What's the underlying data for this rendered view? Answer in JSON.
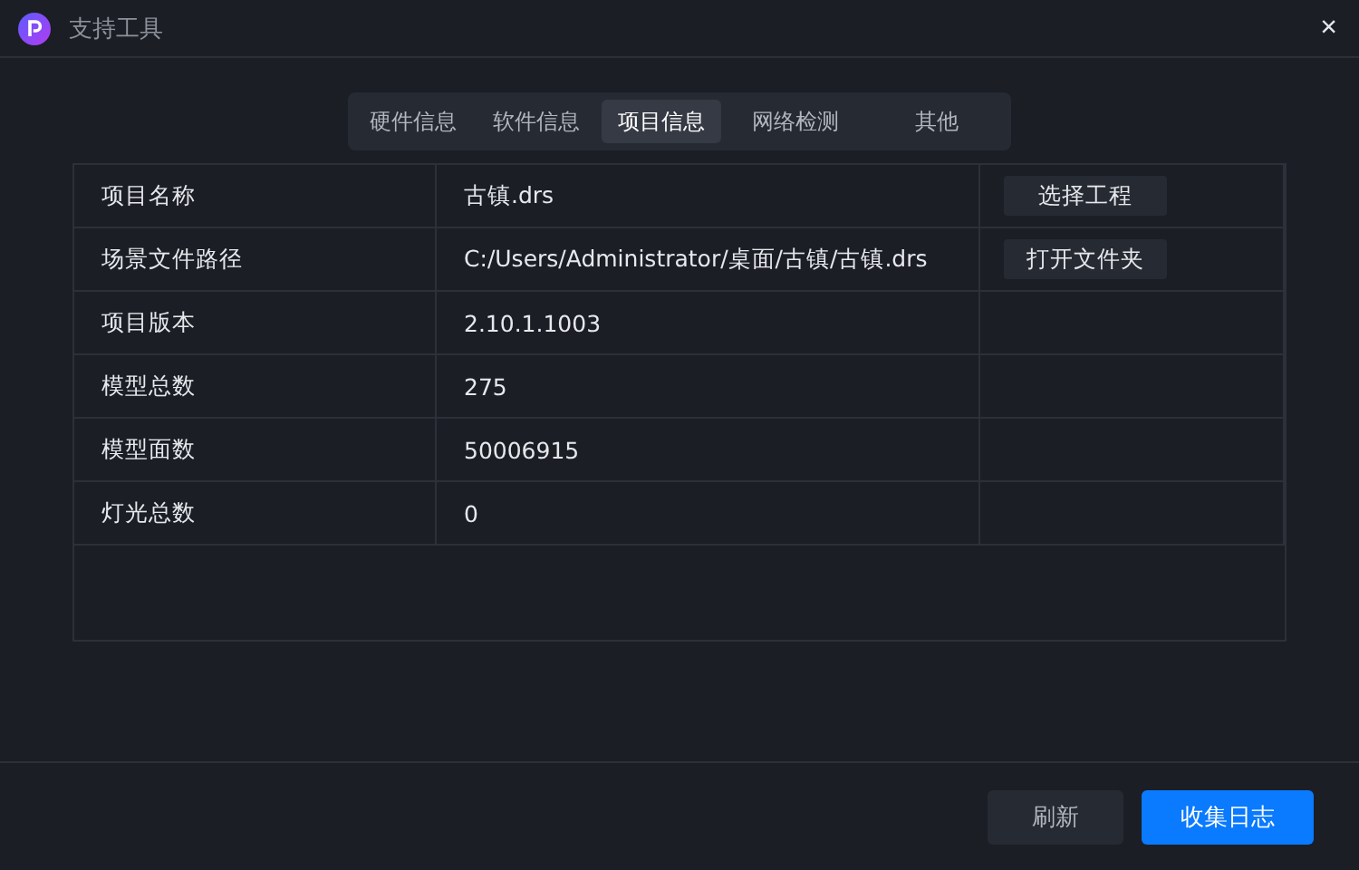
{
  "window": {
    "title": "支持工具",
    "close": "×"
  },
  "tabs": [
    {
      "label": "硬件信息",
      "selected": false
    },
    {
      "label": "软件信息",
      "selected": false
    },
    {
      "label": "项目信息",
      "selected": true
    },
    {
      "label": "网络检测",
      "selected": false
    },
    {
      "label": "其他",
      "selected": false
    }
  ],
  "table": {
    "rows": [
      {
        "label": "项目名称",
        "value": "古镇.drs",
        "action": "选择工程"
      },
      {
        "label": "场景文件路径",
        "value": "C:/Users/Administrator/桌面/古镇/古镇.drs",
        "action": "打开文件夹"
      },
      {
        "label": "项目版本",
        "value": "2.10.1.1003"
      },
      {
        "label": "模型总数",
        "value": "275"
      },
      {
        "label": "模型面数",
        "value": "50006915"
      },
      {
        "label": "灯光总数",
        "value": "0"
      }
    ]
  },
  "buttons": [
    {
      "label": "刷新",
      "kind": "secondary"
    },
    {
      "label": "收集日志",
      "kind": "primary"
    }
  ]
}
